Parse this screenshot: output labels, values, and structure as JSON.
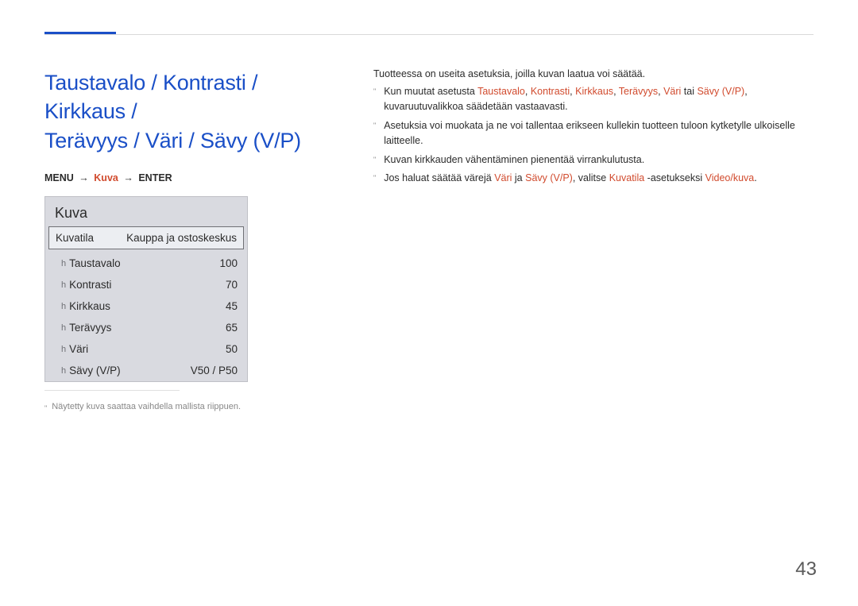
{
  "page_number": "43",
  "title_line1": "Taustavalo / Kontrasti / Kirkkaus /",
  "title_line2": "Terävyys / Väri / Sävy (V/P)",
  "breadcrumb": {
    "menu": "MENU",
    "arrow": "→",
    "kuva": "Kuva",
    "enter": "ENTER"
  },
  "panel": {
    "title": "Kuva",
    "rows": [
      {
        "label": "Kuvatila",
        "value": "Kauppa ja ostoskeskus",
        "selected": true,
        "prefix": ""
      },
      {
        "label": "Taustavalo",
        "value": "100",
        "selected": false,
        "prefix": "h"
      },
      {
        "label": "Kontrasti",
        "value": "70",
        "selected": false,
        "prefix": "h"
      },
      {
        "label": "Kirkkaus",
        "value": "45",
        "selected": false,
        "prefix": "h"
      },
      {
        "label": "Terävyys",
        "value": "65",
        "selected": false,
        "prefix": "h"
      },
      {
        "label": "Väri",
        "value": "50",
        "selected": false,
        "prefix": "h"
      },
      {
        "label": "Sävy (V/P)",
        "value": "V50 / P50",
        "selected": false,
        "prefix": "h"
      }
    ]
  },
  "footnote_left": "Näytetty kuva saattaa vaihdella mallista riippuen.",
  "intro": "Tuotteessa on useita asetuksia, joilla kuvan laatua voi säätää.",
  "bullets": {
    "b1_pre": "Kun muutat asetusta ",
    "b1_t1": "Taustavalo",
    "b1_c": ", ",
    "b1_t2": "Kontrasti",
    "b1_t3": "Kirkkaus",
    "b1_t4": "Terävyys",
    "b1_t5": "Väri",
    "b1_or": " tai ",
    "b1_t6": "Sävy (V/P)",
    "b1_post": ", kuvaruutuvalikkoa säädetään vastaavasti.",
    "b2": "Asetuksia voi muokata ja ne voi tallentaa erikseen kullekin tuotteen tuloon kytketylle ulkoiselle laitteelle.",
    "b3": "Kuvan kirkkauden vähentäminen pienentää virrankulutusta.",
    "b4_pre": "Jos haluat säätää värejä ",
    "b4_t1": "Väri",
    "b4_and": " ja ",
    "b4_t2": "Sävy (V/P)",
    "b4_mid": ", valitse ",
    "b4_t3": "Kuvatila",
    "b4_mid2": " -asetukseksi ",
    "b4_t4": "Video/kuva",
    "b4_end": "."
  }
}
